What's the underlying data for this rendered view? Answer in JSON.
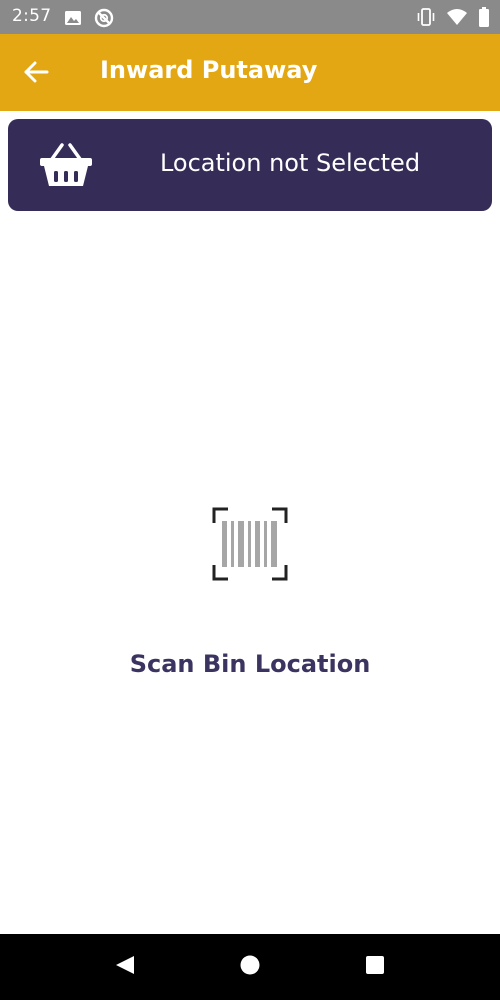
{
  "status_bar": {
    "time": "2:57",
    "left_icons": [
      "image-icon",
      "sync-disabled-icon"
    ],
    "right_icons": [
      "vibrate-icon",
      "wifi-icon",
      "battery-icon"
    ]
  },
  "app_bar": {
    "title": "Inward Putaway",
    "back_icon": "arrow-left-icon",
    "background": "#e3a714"
  },
  "location_card": {
    "text": "Location not Selected",
    "icon": "basket-icon",
    "background": "#352d57"
  },
  "scan": {
    "icon": "barcode-scan-icon",
    "label": "Scan Bin Location",
    "label_color": "#3b3460"
  },
  "nav_bar": {
    "buttons": [
      "back-triangle-icon",
      "home-circle-icon",
      "recents-square-icon"
    ]
  }
}
